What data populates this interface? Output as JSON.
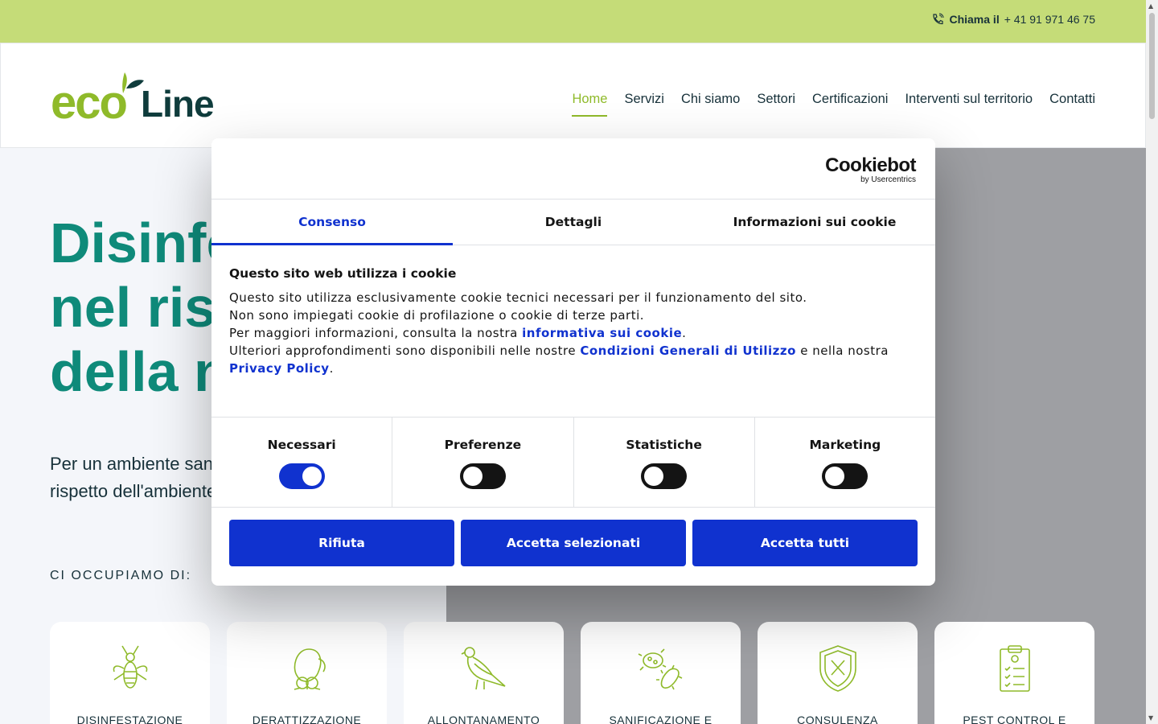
{
  "topbar": {
    "call_prefix": "Chiama il",
    "phone": "+ 41 91 971 46 75"
  },
  "logo": {
    "part1": "eco",
    "part2": "Line"
  },
  "nav": [
    {
      "label": "Home",
      "active": true
    },
    {
      "label": "Servizi"
    },
    {
      "label": "Chi siamo"
    },
    {
      "label": "Settori"
    },
    {
      "label": "Certificazioni"
    },
    {
      "label": "Interventi sul territorio"
    },
    {
      "label": "Contatti"
    }
  ],
  "hero": {
    "title_line1": "Disinfe",
    "title_line2": "nel risp",
    "title_line3": "della n",
    "subtitle_line1": "Per un ambiente sano",
    "subtitle_line2": "rispetto dell'ambiente",
    "section_label": "CI OCCUPIAMO DI:"
  },
  "services": [
    {
      "label": "DISINFESTAZIONE",
      "icon": "wasp-icon"
    },
    {
      "label": "DERATTIZZAZIONE",
      "icon": "mouse-icon"
    },
    {
      "label": "ALLONTANAMENTO",
      "icon": "pigeon-icon"
    },
    {
      "label": "SANIFICAZIONE E",
      "icon": "bacteria-icon"
    },
    {
      "label": "CONSULENZA",
      "icon": "shield-icon"
    },
    {
      "label": "PEST CONTROL E",
      "icon": "checklist-icon"
    }
  ],
  "cookie": {
    "brand": "Cookiebot",
    "brand_by": "by Usercentrics",
    "tabs": [
      "Consenso",
      "Dettagli",
      "Informazioni sui cookie"
    ],
    "heading": "Questo sito web utilizza i cookie",
    "text1": "Questo sito utilizza esclusivamente cookie tecnici necessari per il funzionamento del sito.",
    "text2": "Non sono impiegati cookie di profilazione o cookie di terze parti.",
    "text3_pre": "Per maggiori informazioni, consulta la nostra ",
    "text3_link": "informativa sui cookie",
    "text3_post": ".",
    "text4_pre": "Ulteriori approfondimenti sono disponibili nelle nostre ",
    "text4_link": "Condizioni Generali di Utilizzo",
    "text4_mid": " e nella nostra ",
    "text4_link2": "Privacy Policy",
    "text4_post": ".",
    "toggles": [
      {
        "label": "Necessari",
        "on": true
      },
      {
        "label": "Preferenze",
        "on": false
      },
      {
        "label": "Statistiche",
        "on": false
      },
      {
        "label": "Marketing",
        "on": false
      }
    ],
    "buttons": [
      "Rifiuta",
      "Accetta selezionati",
      "Accetta tutti"
    ]
  },
  "colors": {
    "accent": "#8fba2a",
    "teal": "#0f8a7a",
    "cookie_blue": "#1032cf",
    "topbar": "#c5dc78"
  }
}
